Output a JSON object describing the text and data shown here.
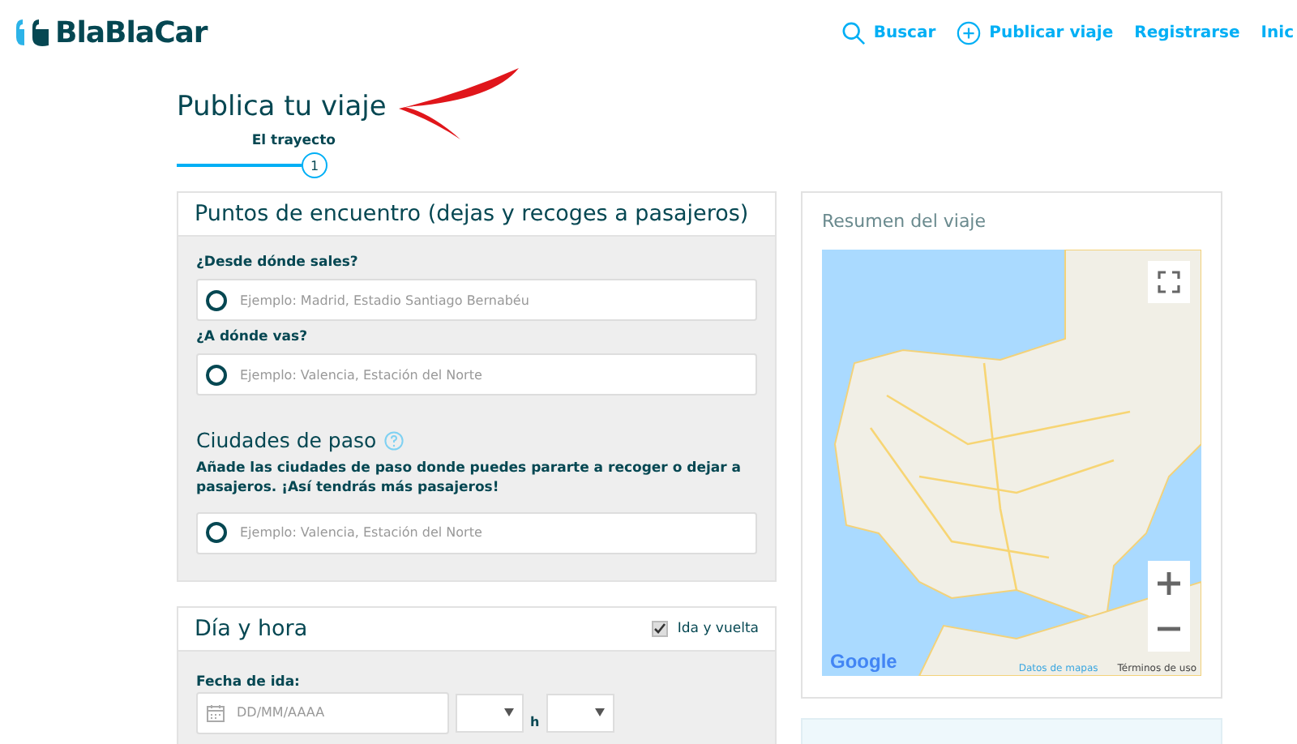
{
  "header": {
    "logo": "BlaBlaCar",
    "nav": [
      {
        "kind": "search",
        "label": "Buscar"
      },
      {
        "kind": "add",
        "label": "Publicar viaje"
      },
      {
        "kind": "plain",
        "label": "Registrarse"
      },
      {
        "kind": "plain",
        "label": "Inic"
      }
    ]
  },
  "page_title": "Publica tu viaje",
  "steps": [
    {
      "label": "El trayecto",
      "number": "1",
      "selected": true
    }
  ],
  "meeting_points": {
    "title": "Puntos de encuentro (dejas y recoges a pasajeros)",
    "fields": [
      {
        "label": "¿Desde dónde sales?",
        "placeholder": "Ejemplo: Madrid, Estadio Santiago Bernabéu"
      },
      {
        "label": "¿A dónde vas?",
        "placeholder": "Ejemplo: Valencia, Estación del Norte"
      }
    ],
    "stopovers": {
      "title": "Ciudades de paso",
      "description": "Añade las ciudades de paso donde puedes pararte a recoger o dejar a pasajeros. ¡Así tendrás más pasajeros!",
      "placeholder": "Ejemplo: Valencia, Estación del Norte"
    }
  },
  "date_time": {
    "title": "Día y hora",
    "round_trip": {
      "label": "Ida y vuelta",
      "checked": true
    },
    "date_label": "Fecha de ida:",
    "date_placeholder": "DD/MM/AAAA",
    "hour_unit": "h"
  },
  "summary": {
    "title": "Resumen del viaje",
    "map": {
      "logo": "Google",
      "links": [
        "Datos de mapas",
        "Términos de uso"
      ]
    }
  }
}
